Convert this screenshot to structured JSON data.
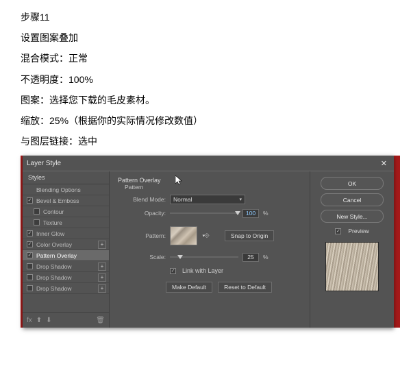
{
  "instructions": {
    "step": "步骤11",
    "line1": "设置图案叠加",
    "line2": "混合模式：正常",
    "line3": "不透明度：100%",
    "line4": "图案：选择您下载的毛皮素材。",
    "line5": "缩放：25%（根据你的实际情况修改数值）",
    "line6": "与图层链接：选中"
  },
  "dialog": {
    "title": "Layer Style",
    "close": "✕",
    "styles_header": "Styles",
    "items": [
      {
        "label": "Blending Options",
        "checkbox": false,
        "checked": false,
        "indent": false,
        "plus": false
      },
      {
        "label": "Bevel & Emboss",
        "checkbox": true,
        "checked": true,
        "indent": false,
        "plus": false
      },
      {
        "label": "Contour",
        "checkbox": true,
        "checked": false,
        "indent": true,
        "plus": false
      },
      {
        "label": "Texture",
        "checkbox": true,
        "checked": false,
        "indent": true,
        "plus": false
      },
      {
        "label": "Inner Glow",
        "checkbox": true,
        "checked": true,
        "indent": false,
        "plus": false
      },
      {
        "label": "Color Overlay",
        "checkbox": true,
        "checked": true,
        "indent": false,
        "plus": true
      },
      {
        "label": "Pattern Overlay",
        "checkbox": true,
        "checked": true,
        "indent": false,
        "plus": false,
        "selected": true
      },
      {
        "label": "Drop Shadow",
        "checkbox": true,
        "checked": false,
        "indent": false,
        "plus": true
      },
      {
        "label": "Drop Shadow",
        "checkbox": true,
        "checked": false,
        "indent": false,
        "plus": true
      },
      {
        "label": "Drop Shadow",
        "checkbox": true,
        "checked": false,
        "indent": false,
        "plus": true
      }
    ],
    "footer_fx": "fx",
    "settings": {
      "group_title": "Pattern Overlay",
      "group_sub": "Pattern",
      "blend_label": "Blend Mode:",
      "blend_value": "Normal",
      "opacity_label": "Opacity:",
      "opacity_value": "100",
      "pattern_label": "Pattern:",
      "snap_label": "Snap to Origin",
      "scale_label": "Scale:",
      "scale_value": "25",
      "pct": "%",
      "link_label": "Link with Layer",
      "make_default": "Make Default",
      "reset_default": "Reset to Default"
    },
    "right": {
      "ok": "OK",
      "cancel": "Cancel",
      "new_style": "New Style...",
      "preview_label": "Preview"
    }
  }
}
